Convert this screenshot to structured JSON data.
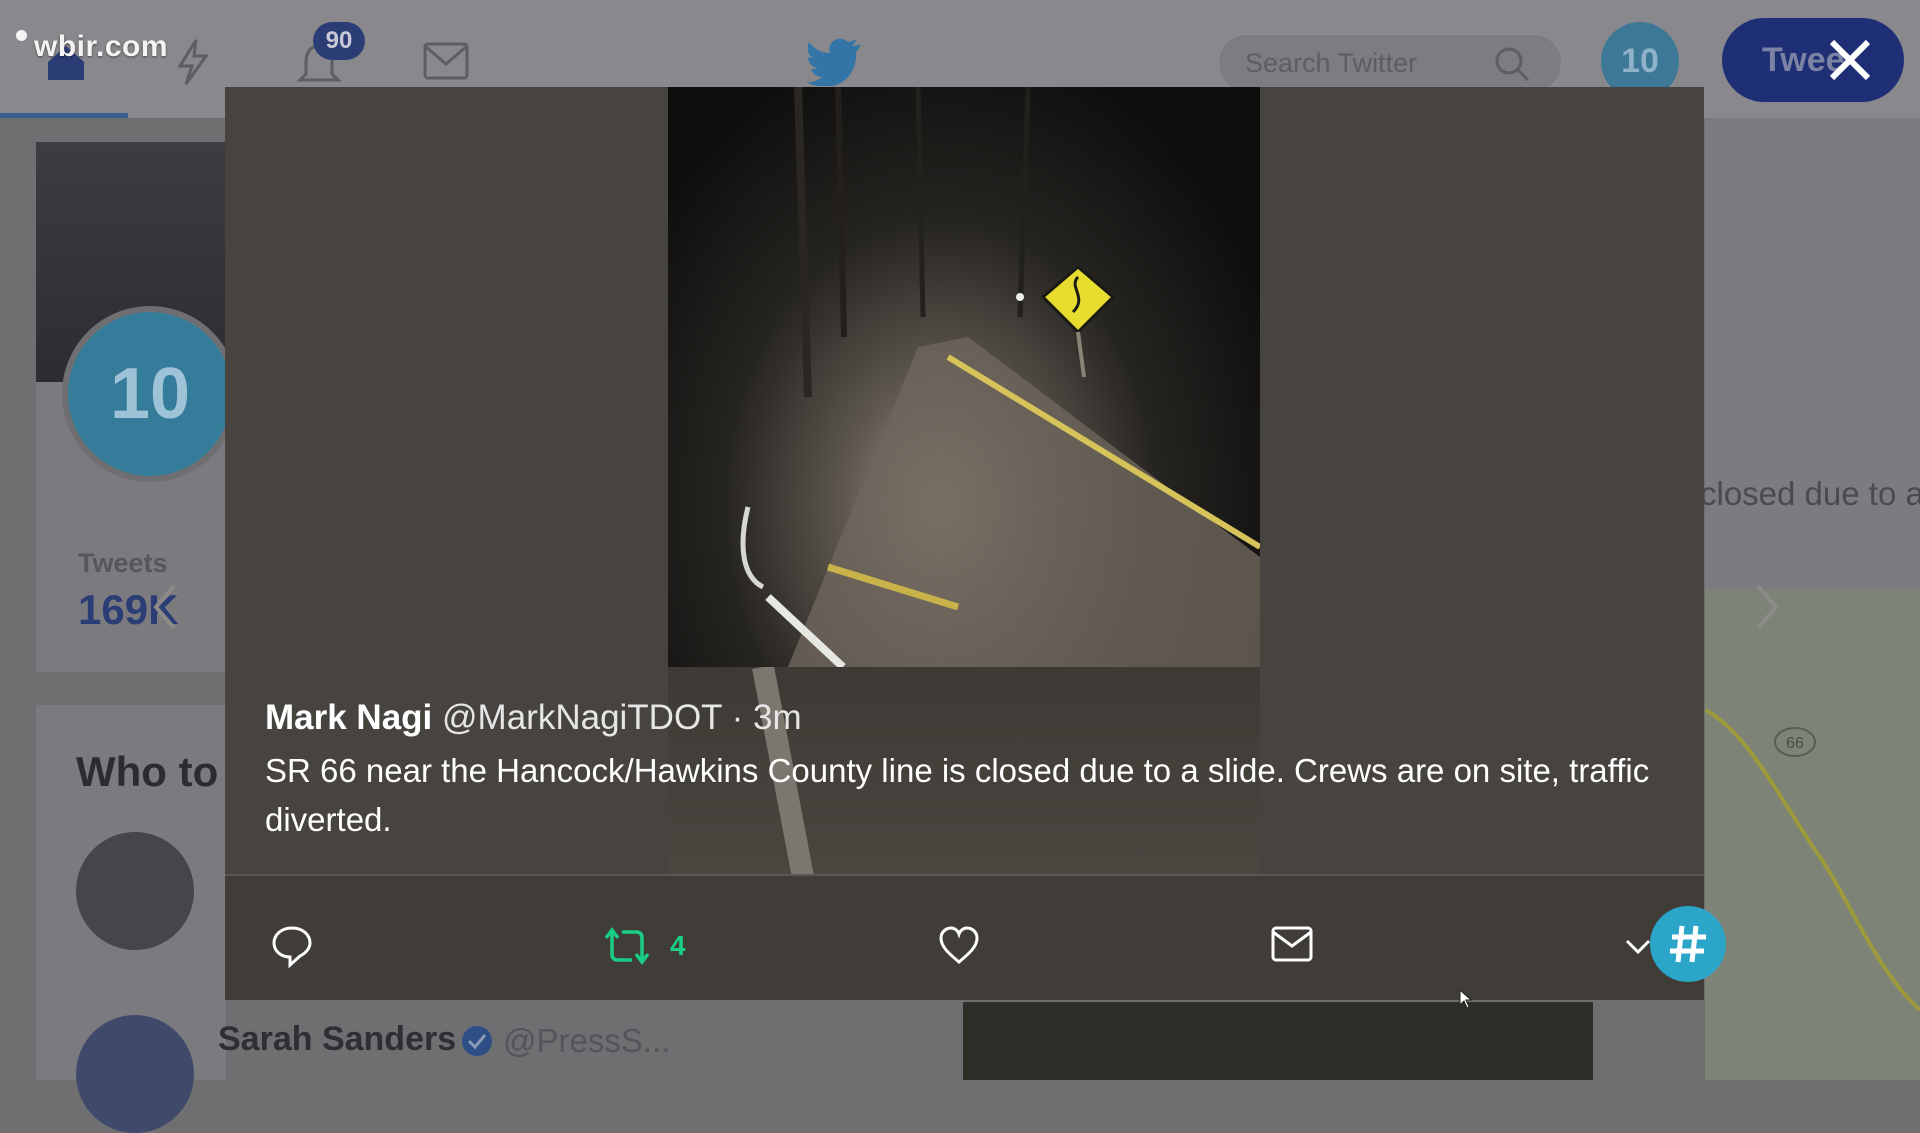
{
  "header": {
    "site_watermark": "wbir.com",
    "notifications_count": "90",
    "search_placeholder": "Search Twitter",
    "tweet_button_label": "Twee",
    "avatar_text": "10"
  },
  "profile": {
    "avatar_text": "10",
    "stats_label": "Tweets",
    "stats_value": "169K"
  },
  "who_to_follow": {
    "title": "Who to",
    "suggestion_name": "Sarah Sanders",
    "suggestion_handle": "@PressS..."
  },
  "background_right_text": "closed due to a",
  "modal": {
    "tweet": {
      "author_name": "Mark Nagi",
      "author_handle": "@MarkNagiTDOT",
      "time": "· 3m",
      "text": "SR 66 near the Hancock/Hawkins County line is closed due to a slide. Crews are on site, traffic diverted.",
      "retweet_count": "4"
    },
    "map_route_label": "66"
  },
  "colors": {
    "retweet_green": "#19cf86",
    "fab_teal": "#2ba6c9",
    "modal_bg": "#474440",
    "twitter_blue_dimmed": "#1f2f75"
  },
  "icons": [
    "home-icon",
    "moments-icon",
    "notifications-icon",
    "messages-icon",
    "twitter-bird-icon",
    "search-icon",
    "close-icon",
    "reply-icon",
    "retweet-icon",
    "like-icon",
    "direct-message-icon",
    "chevron-down-icon",
    "hashtag-icon",
    "prev-arrow-icon",
    "next-arrow-icon",
    "cursor-icon"
  ]
}
